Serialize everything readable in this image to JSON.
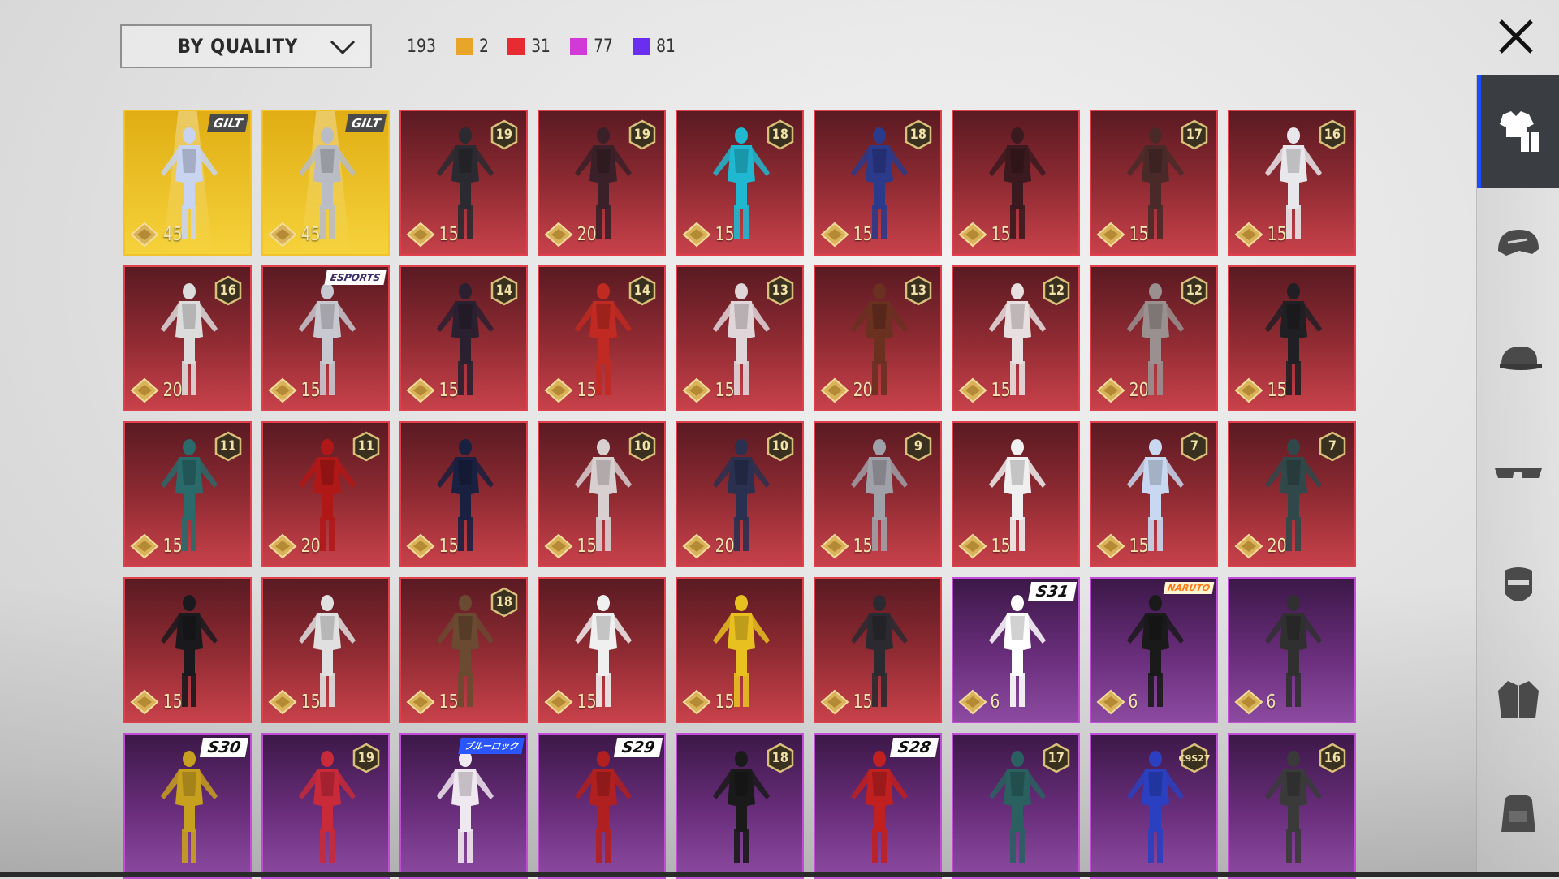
{
  "toolbar": {
    "sort_label": "BY QUALITY",
    "total": "193",
    "quality_counts": [
      {
        "color": "#e8a52a",
        "count": "2"
      },
      {
        "color": "#e82a32",
        "count": "31"
      },
      {
        "color": "#d23ad8",
        "count": "77"
      },
      {
        "color": "#6a2ef0",
        "count": "81"
      }
    ]
  },
  "icons": {
    "close": "close-icon",
    "sidebar": [
      "outfit-icon",
      "helmet-icon",
      "cap-icon",
      "glasses-icon",
      "mask-icon",
      "jacket-icon",
      "backpack-icon"
    ]
  },
  "colors": {
    "accent": "#1c4cff",
    "mythic": "#f2c32a",
    "legendary": "#e0414d",
    "epic": "#c14ed6",
    "coin": "#d9b25a"
  },
  "items": [
    {
      "quality": "gold",
      "tag": "GILT",
      "tag_type": "gilt",
      "cost": "45",
      "palette": "#c8d4f0"
    },
    {
      "quality": "gold",
      "tag": "GILT",
      "tag_type": "gilt",
      "cost": "45",
      "palette": "#b9bcc4"
    },
    {
      "quality": "red",
      "rank": "19",
      "cost": "15",
      "palette": "#2a2a30"
    },
    {
      "quality": "red",
      "rank": "19",
      "cost": "20",
      "palette": "#3a2028"
    },
    {
      "quality": "red",
      "rank": "18",
      "cost": "15",
      "palette": "#1fb8d0"
    },
    {
      "quality": "red",
      "rank": "18",
      "cost": "15",
      "palette": "#2b3a8a"
    },
    {
      "quality": "red",
      "cost": "15",
      "palette": "#3a1a1e"
    },
    {
      "quality": "red",
      "rank": "17",
      "cost": "15",
      "palette": "#4a2a28"
    },
    {
      "quality": "red",
      "rank": "16",
      "cost": "15",
      "palette": "#e8e8ec"
    },
    {
      "quality": "red",
      "rank": "16",
      "cost": "20",
      "palette": "#dcdcdc"
    },
    {
      "quality": "red",
      "tag": "ESPORTS",
      "tag_type": "esports",
      "cost": "15",
      "palette": "#c8c8d0"
    },
    {
      "quality": "red",
      "rank": "14",
      "cost": "15",
      "palette": "#2a2030"
    },
    {
      "quality": "red",
      "rank": "14",
      "cost": "15",
      "palette": "#c02a22"
    },
    {
      "quality": "red",
      "rank": "13",
      "cost": "15",
      "palette": "#e0d6da"
    },
    {
      "quality": "red",
      "rank": "13",
      "cost": "20",
      "palette": "#6a3020"
    },
    {
      "quality": "red",
      "rank": "12",
      "cost": "15",
      "palette": "#e8e0e0"
    },
    {
      "quality": "red",
      "rank": "12",
      "cost": "20",
      "palette": "#9a9090"
    },
    {
      "quality": "red",
      "cost": "15",
      "palette": "#202024"
    },
    {
      "quality": "red",
      "rank": "11",
      "cost": "15",
      "palette": "#2a6a6a"
    },
    {
      "quality": "red",
      "rank": "11",
      "cost": "20",
      "palette": "#b01818"
    },
    {
      "quality": "red",
      "cost": "15",
      "palette": "#1a2040"
    },
    {
      "quality": "red",
      "rank": "10",
      "cost": "15",
      "palette": "#d8d0d0"
    },
    {
      "quality": "red",
      "rank": "10",
      "cost": "20",
      "palette": "#2a3050"
    },
    {
      "quality": "red",
      "rank": "9",
      "cost": "15",
      "palette": "#a0a0a8"
    },
    {
      "quality": "red",
      "cost": "15",
      "palette": "#f0f0f0"
    },
    {
      "quality": "red",
      "rank": "7",
      "cost": "15",
      "palette": "#c8d8f0"
    },
    {
      "quality": "red",
      "rank": "7",
      "cost": "20",
      "palette": "#30484a"
    },
    {
      "quality": "red",
      "cost": "15",
      "palette": "#1a1a1e"
    },
    {
      "quality": "red",
      "cost": "15",
      "palette": "#e0e0e0"
    },
    {
      "quality": "red",
      "rank": "18",
      "cost": "15",
      "palette": "#6a4a30"
    },
    {
      "quality": "red",
      "cost": "15",
      "palette": "#f0f0f0"
    },
    {
      "quality": "red",
      "cost": "15",
      "palette": "#e8c020"
    },
    {
      "quality": "red",
      "cost": "15",
      "palette": "#2a2a30"
    },
    {
      "quality": "purple",
      "tag": "S31",
      "tag_type": "season",
      "cost": "6",
      "palette": "#ffffff"
    },
    {
      "quality": "purple",
      "tag": "NARUTO",
      "tag_type": "naruto",
      "cost": "6",
      "palette": "#1a1a1a"
    },
    {
      "quality": "purple",
      "cost": "6",
      "palette": "#303030"
    },
    {
      "quality": "purple",
      "tag": "S30",
      "tag_type": "season",
      "palette": "#c8a020"
    },
    {
      "quality": "purple",
      "rank": "19",
      "palette": "#c82a3a"
    },
    {
      "quality": "purple",
      "tag": "ブルーロック",
      "tag_type": "jp",
      "palette": "#f0e8f0"
    },
    {
      "quality": "purple",
      "tag": "S29",
      "tag_type": "season",
      "palette": "#b02020"
    },
    {
      "quality": "purple",
      "rank": "18",
      "palette": "#1a1a1a"
    },
    {
      "quality": "purple",
      "tag": "S28",
      "tag_type": "season",
      "palette": "#c02020"
    },
    {
      "quality": "purple",
      "rank": "17",
      "palette": "#2a6060"
    },
    {
      "quality": "purple",
      "rank": "C9S27",
      "palette": "#2a40c0"
    },
    {
      "quality": "purple",
      "rank": "16",
      "palette": "#3a3a3a"
    }
  ]
}
